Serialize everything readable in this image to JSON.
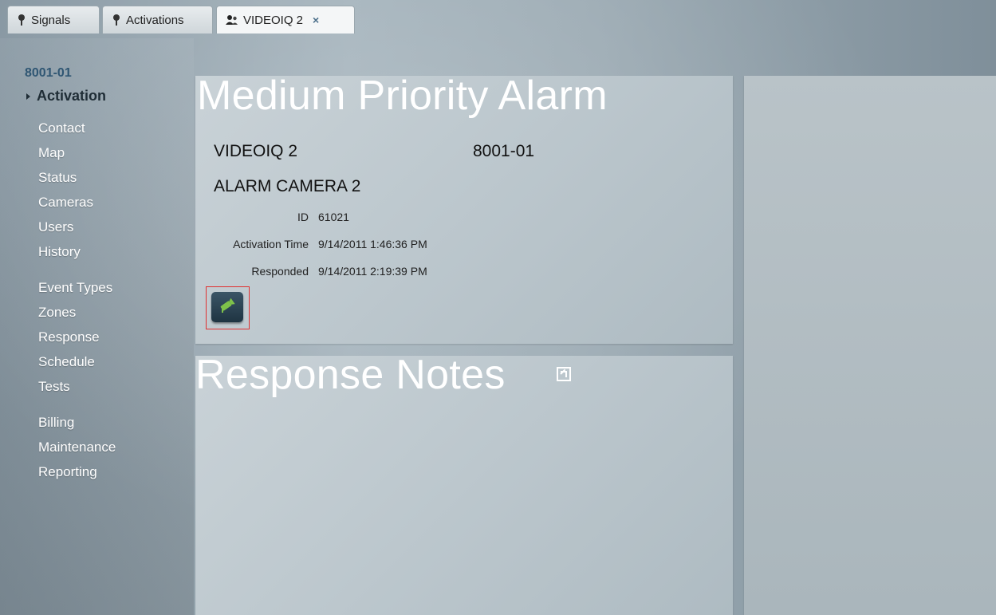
{
  "tabs": [
    {
      "label": "Signals",
      "icon": "pin-icon",
      "active": false
    },
    {
      "label": "Activations",
      "icon": "pin-icon",
      "active": false
    },
    {
      "label": "VIDEOIQ 2",
      "icon": "users-icon",
      "active": true,
      "closable": true,
      "close_glyph": "×"
    }
  ],
  "sidebar": {
    "site_code": "8001-01",
    "current": "Activation",
    "groups": [
      [
        "Contact",
        "Map",
        "Status",
        "Cameras",
        "Users",
        "History"
      ],
      [
        "Event Types",
        "Zones",
        "Response",
        "Schedule",
        "Tests"
      ],
      [
        "Billing",
        "Maintenance",
        "Reporting"
      ]
    ]
  },
  "alarm": {
    "title": "Medium Priority Alarm",
    "site_name": "VIDEOIQ 2",
    "site_number": "8001-01",
    "zone_name": "ALARM CAMERA 2",
    "fields": [
      {
        "label": "ID",
        "value": "61021"
      },
      {
        "label": "Activation Time",
        "value": "9/14/2011 1:46:36 PM"
      },
      {
        "label": "Responded",
        "value": "9/14/2011 2:19:39 PM"
      }
    ]
  },
  "notes": {
    "title": "Response Notes"
  },
  "colors": {
    "accent_text": "#2f5673",
    "camera_icon": "#7fc24a",
    "highlight_border": "#e03030"
  }
}
